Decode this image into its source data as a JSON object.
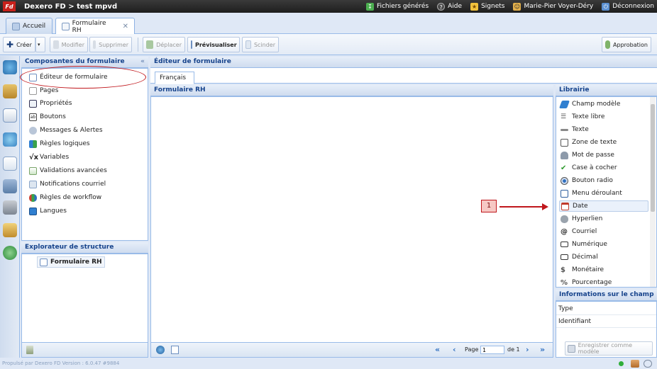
{
  "topbar": {
    "logo": "Fd",
    "title": "Dexero FD > test mpvd",
    "links": [
      {
        "label": "Fichiers générés",
        "icon": "generated-files-icon"
      },
      {
        "label": "Aide",
        "icon": "help-icon"
      },
      {
        "label": "Signets",
        "icon": "bookmarks-icon"
      },
      {
        "label": "Marie-Pier Voyer-Déry",
        "icon": "user-icon"
      },
      {
        "label": "Déconnexion",
        "icon": "logout-icon"
      }
    ]
  },
  "tabs": [
    {
      "label": "Accueil",
      "active": false
    },
    {
      "label": "Formulaire RH",
      "active": true,
      "close": "✕"
    }
  ],
  "toolbar": {
    "create": "Créer",
    "modify": "Modifier",
    "delete": "Supprimer",
    "move": "Déplacer",
    "preview": "Prévisualiser",
    "split": "Scinder",
    "approval": "Approbation"
  },
  "components": {
    "title": "Composantes du formulaire",
    "collapse": "«",
    "items": [
      "Éditeur de formulaire",
      "Pages",
      "Propriétés",
      "Boutons",
      "Messages & Alertes",
      "Règles logiques",
      "Variables",
      "Validations avancées",
      "Notifications courriel",
      "Règles de workflow",
      "Langues"
    ]
  },
  "structure": {
    "title": "Explorateur de structure",
    "root": "Formulaire RH"
  },
  "editor": {
    "title": "Éditeur de formulaire",
    "lang_tab": "Français",
    "form_title": "Formulaire RH",
    "pager": {
      "page_label": "Page",
      "page_value": "1",
      "of_label": "de 1"
    }
  },
  "library": {
    "title": "Librairie",
    "items": [
      "Champ modèle",
      "Texte libre",
      "Texte",
      "Zone de texte",
      "Mot de passe",
      "Case à cocher",
      "Bouton radio",
      "Menu déroulant",
      "Date",
      "Hyperlien",
      "Courriel",
      "Numérique",
      "Décimal",
      "Monétaire",
      "Pourcentage"
    ],
    "selected": "Date"
  },
  "field_info": {
    "title": "Informations sur le champ",
    "rows": [
      "Type",
      "Identifiant"
    ],
    "save_button": "Enregistrer comme modèle"
  },
  "annotation": {
    "number": "1"
  },
  "status": {
    "text": "Propulsé par Dexero FD Version : 6.0.47 #9884"
  },
  "colors": {
    "accent": "#15428b",
    "border": "#99bbe8",
    "annotation": "#c0171c"
  }
}
